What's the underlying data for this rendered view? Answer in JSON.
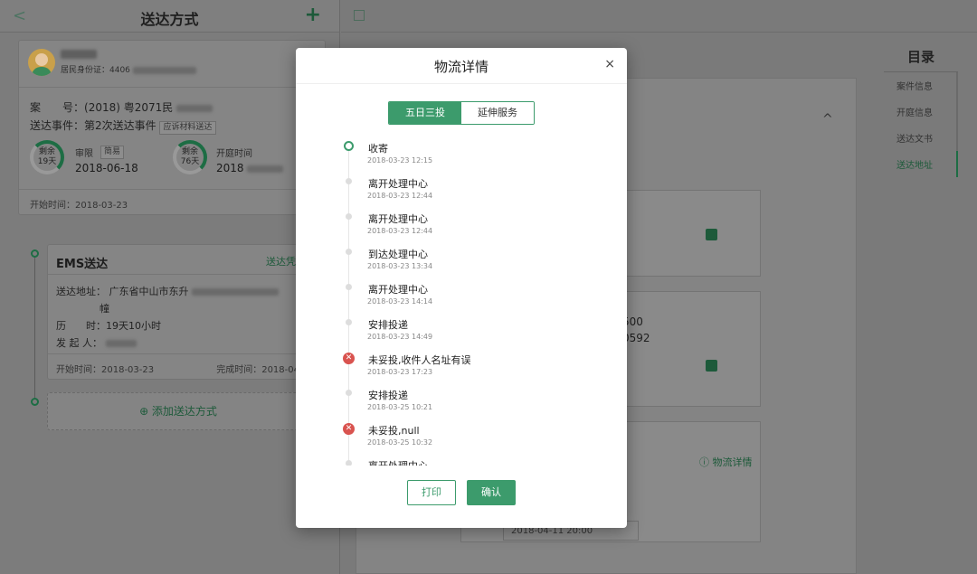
{
  "left": {
    "title": "送达方式",
    "person_id_label": "居民身份证：4406",
    "case_label": "案　　号：",
    "case_no": "(2018) 粤2071民",
    "event_label": "送达事件：",
    "event_value": "第2次送达事件",
    "event_tag": "应诉材料送达",
    "ring1": {
      "line1": "剩余",
      "line2": "19天",
      "label": "审限",
      "tag": "简易",
      "date": "2018-06-18"
    },
    "ring2": {
      "line1": "剩余",
      "line2": "76天",
      "label": "开庭时间",
      "date": "2018"
    },
    "start_time": "开始时间：2018-03-23",
    "ems": {
      "title": "EMS送达",
      "link": "送达凭",
      "address_label": "送达地址：",
      "address_value": "广东省中山市东升",
      "address_line2": "幢",
      "duration_label": "历　　时：",
      "duration_value": "19天10小时",
      "initiator_label": "发 起 人：",
      "start_time": "开始时间：2018-03-23",
      "end_time": "完成时间：2018-04"
    },
    "add_label": "⊕ 添加送达方式"
  },
  "right": {
    "toc_title": "目录",
    "toc_items": [
      "案件信息",
      "开庭信息",
      "送达文书",
      "送达地址"
    ],
    "box2_line1": "500",
    "box2_line2": "0592",
    "log_link": "ⓘ 物流详情",
    "date_value": "2018-04-11 20:00"
  },
  "modal": {
    "title": "物流详情",
    "close": "×",
    "tabs": [
      "五日三投",
      "延伸服务"
    ],
    "events": [
      {
        "name": "收寄",
        "time": "2018-03-23 12:15",
        "type": "start"
      },
      {
        "name": "离开处理中心",
        "time": "2018-03-23 12:44",
        "type": "normal"
      },
      {
        "name": "离开处理中心",
        "time": "2018-03-23 12:44",
        "type": "normal"
      },
      {
        "name": "到达处理中心",
        "time": "2018-03-23 13:34",
        "type": "normal"
      },
      {
        "name": "离开处理中心",
        "time": "2018-03-23 14:14",
        "type": "normal"
      },
      {
        "name": "安排投递",
        "time": "2018-03-23 14:49",
        "type": "normal"
      },
      {
        "name": "未妥投,收件人名址有误",
        "time": "2018-03-23 17:23",
        "type": "error"
      },
      {
        "name": "安排投递",
        "time": "2018-03-25 10:21",
        "type": "normal"
      },
      {
        "name": "未妥投,null",
        "time": "2018-03-25 10:32",
        "type": "error"
      },
      {
        "name": "离开处理中心",
        "time": "",
        "type": "normal"
      }
    ],
    "print_label": "打印",
    "confirm_label": "确认"
  },
  "colors": {
    "accent": "#3c9b6c",
    "error": "#d9534f"
  }
}
